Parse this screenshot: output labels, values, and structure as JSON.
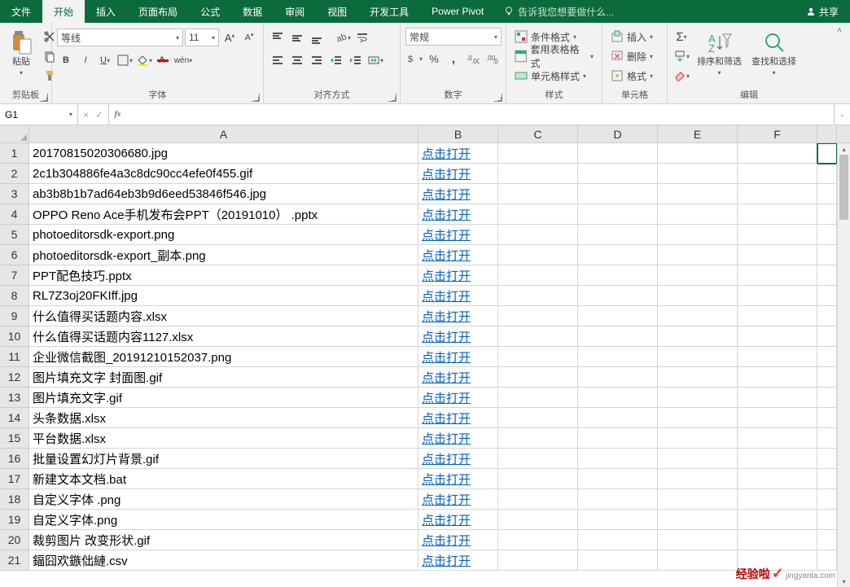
{
  "tabs": {
    "items": [
      "文件",
      "开始",
      "插入",
      "页面布局",
      "公式",
      "数据",
      "审阅",
      "视图",
      "开发工具",
      "Power Pivot"
    ],
    "active_index": 1,
    "tell_me": "告诉我您想要做什么...",
    "share": "共享"
  },
  "ribbon": {
    "clipboard": {
      "paste": "粘贴",
      "label": "剪贴板"
    },
    "font": {
      "name": "等线",
      "size": "11",
      "b": "B",
      "i": "I",
      "u": "U",
      "ph": "wén",
      "label": "字体"
    },
    "align": {
      "label": "对齐方式"
    },
    "number": {
      "format": "常规",
      "label": "数字"
    },
    "styles": {
      "cond": "条件格式",
      "table": "套用表格格式",
      "cell": "单元格样式",
      "label": "样式"
    },
    "cells": {
      "insert": "插入",
      "delete": "删除",
      "format": "格式",
      "label": "单元格"
    },
    "editing": {
      "sort": "排序和筛选",
      "find": "查找和选择",
      "label": "编辑"
    }
  },
  "namebox": "G1",
  "fx_icons": {
    "cancel": "×",
    "confirm": "✓"
  },
  "columns": [
    "A",
    "B",
    "C",
    "D",
    "E",
    "F"
  ],
  "link_text": "点击打开",
  "rows": [
    "20170815020306680.jpg",
    "2c1b304886fe4a3c8dc90cc4efe0f455.gif",
    "ab3b8b1b7ad64eb3b9d6eed53846f546.jpg",
    "OPPO Reno Ace手机发布会PPT（20191010） .pptx",
    "photoeditorsdk-export.png",
    "photoeditorsdk-export_副本.png",
    "PPT配色技巧.pptx",
    "RL7Z3oj20FKIff.jpg",
    "什么值得买话题内容.xlsx",
    "什么值得买话题内容1127.xlsx",
    "企业微信截图_20191210152037.png",
    "图片填充文字 封面图.gif",
    "图片填充文字.gif",
    "头条数据.xlsx",
    "平台数据.xlsx",
    "批量设置幻灯片背景.gif",
    "新建文本文档.bat",
    "自定义字体 .png",
    "自定义字体.png",
    "裁剪图片 改变形状.gif",
    "鍢囧欢鏃㑁縺.csv"
  ],
  "watermark": {
    "main": "经验啦",
    "check": "✓",
    "sub": "jingyanla.com"
  }
}
